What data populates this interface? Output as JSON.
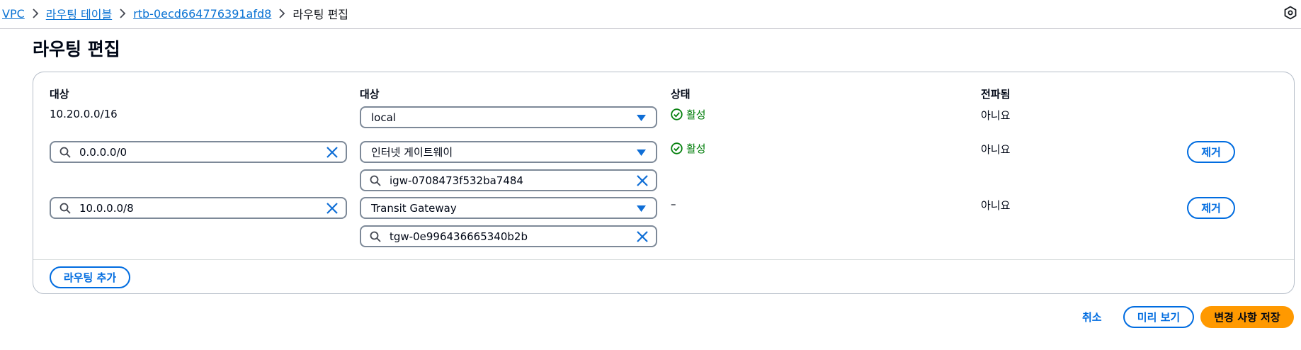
{
  "breadcrumb": {
    "items": [
      "VPC",
      "라우팅 테이블",
      "rtb-0ecd664776391afd8"
    ],
    "current": "라우팅 편집"
  },
  "page": {
    "title": "라우팅 편집"
  },
  "table": {
    "headers": {
      "destination": "대상",
      "target": "대상",
      "status": "상태",
      "propagated": "전파됨"
    },
    "rows": [
      {
        "destination": "10.20.0.0/16",
        "target_type": "local",
        "target_id": "",
        "status": "활성",
        "propagated": "아니요",
        "remove": ""
      },
      {
        "destination": "0.0.0.0/0",
        "target_type": "인터넷 게이트웨이",
        "target_id": "igw-0708473f532ba7484",
        "status": "활성",
        "propagated": "아니요",
        "remove": "제거"
      },
      {
        "destination": "10.0.0.0/8",
        "target_type": "Transit Gateway",
        "target_id": "tgw-0e996436665340b2b",
        "status": "–",
        "propagated": "아니요",
        "remove": "제거"
      }
    ],
    "add_route": "라우팅 추가"
  },
  "footer": {
    "cancel": "취소",
    "preview": "미리 보기",
    "save": "변경 사항 저장"
  },
  "colors": {
    "link": "#0972d3",
    "button": "#006ce0",
    "success": "#037f0c",
    "primary": "#ff9900"
  }
}
